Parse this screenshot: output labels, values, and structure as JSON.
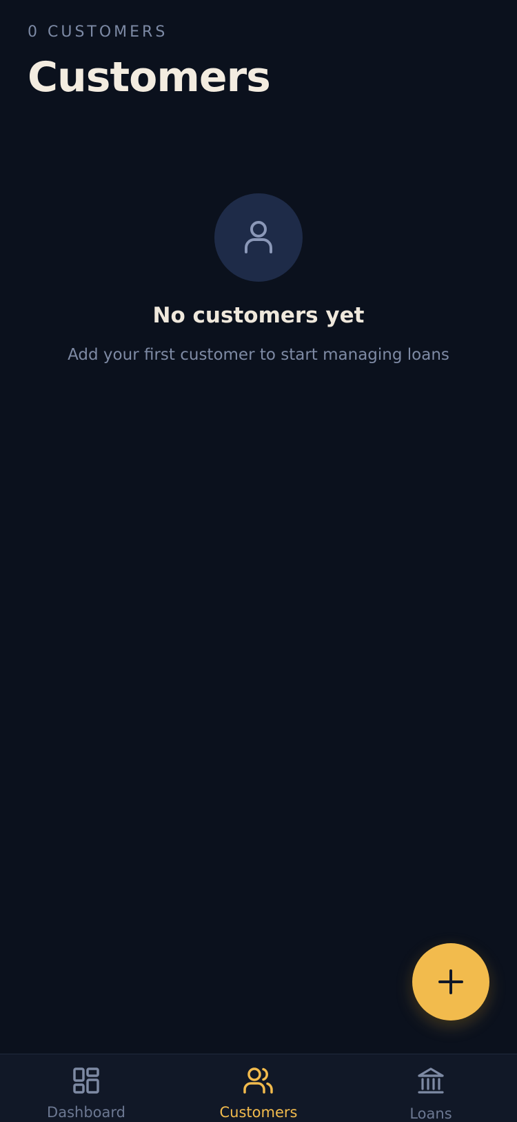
{
  "header": {
    "count_label": "0 CUSTOMERS",
    "title": "Customers"
  },
  "empty_state": {
    "icon": "user-icon",
    "title": "No customers yet",
    "subtitle": "Add your first customer to start managing loans"
  },
  "fab": {
    "icon": "plus-icon"
  },
  "bottom_nav": {
    "items": [
      {
        "label": "Dashboard",
        "icon": "dashboard-grid-icon",
        "active": false
      },
      {
        "label": "Customers",
        "icon": "users-icon",
        "active": true
      },
      {
        "label": "Loans",
        "icon": "bank-icon",
        "active": false
      }
    ]
  },
  "colors": {
    "background": "#0b111d",
    "accent": "#f2bb4d",
    "muted": "#7d8aa5",
    "title_text": "#f3ece0",
    "avatar_bg": "#1e2b48",
    "nav_bg": "#111827"
  }
}
